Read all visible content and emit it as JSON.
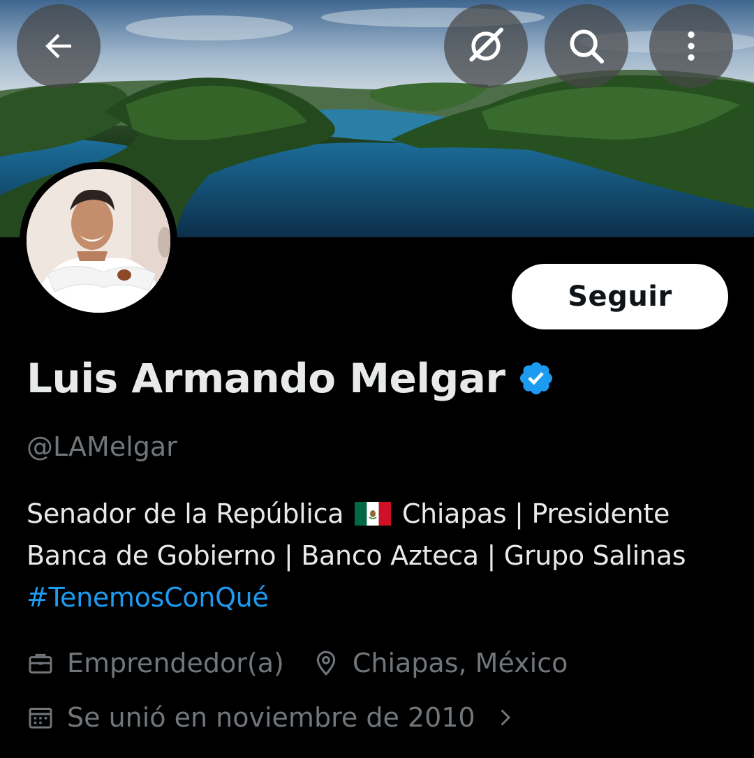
{
  "header": {
    "back_icon": "arrow-left-icon",
    "grok_icon": "grok-icon",
    "search_icon": "search-icon",
    "more_icon": "more-vertical-icon"
  },
  "profile": {
    "follow_label": "Seguir",
    "name": "Luis Armando Melgar",
    "verified": true,
    "handle": "@LAMelgar",
    "bio_part1": "Senador de la República",
    "bio_part2": "Chiapas | Presidente Banca de Gobierno | Banco Azteca | Grupo Salinas",
    "bio_hashtag": "#TenemosConQué",
    "profession": "Emprendedor(a)",
    "location": "Chiapas, México",
    "joined": "Se unió en noviembre de 2010"
  },
  "colors": {
    "background": "#000000",
    "accent": "#1d9bf0",
    "secondary_text": "#71767b",
    "primary_text": "#e7e9ea"
  }
}
